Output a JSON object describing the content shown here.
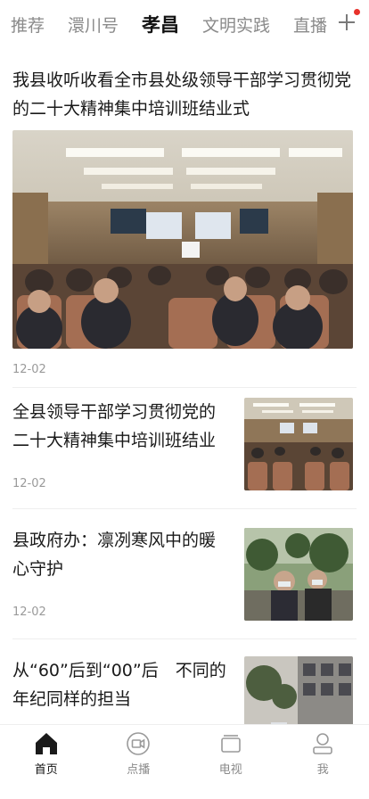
{
  "tabs": [
    {
      "label": "推荐",
      "active": false
    },
    {
      "label": "澴川号",
      "active": false
    },
    {
      "label": "孝昌",
      "active": true
    },
    {
      "label": "文明实践",
      "active": false
    },
    {
      "label": "直播",
      "active": false
    }
  ],
  "feed": {
    "headline": {
      "title": "我县收听收看全市县处级领导干部学习贯彻党的二十大精神集中培训班结业式",
      "image": "meeting-hall-photo",
      "date": "12-02"
    },
    "items": [
      {
        "title": "全县领导干部学习贯彻党的二十大精神集中培训班结业",
        "date": "12-02",
        "image": "meeting-hall-photo"
      },
      {
        "title": "县政府办：凛冽寒风中的暖心守护",
        "date": "12-02",
        "image": "outdoor-people-photo"
      },
      {
        "title": "从“60”后到“00”后　不同的年纪同样的担当",
        "date": "",
        "image": "street-photo"
      }
    ]
  },
  "bottom_nav": [
    {
      "label": "首页",
      "icon": "home-icon",
      "active": true
    },
    {
      "label": "点播",
      "icon": "video-icon",
      "active": false
    },
    {
      "label": "电视",
      "icon": "tv-icon",
      "active": false
    },
    {
      "label": "我",
      "icon": "user-icon",
      "active": false
    }
  ],
  "colors": {
    "accent_red": "#e8322b",
    "active_text": "#111111",
    "inactive_text": "#8a8a8a"
  }
}
